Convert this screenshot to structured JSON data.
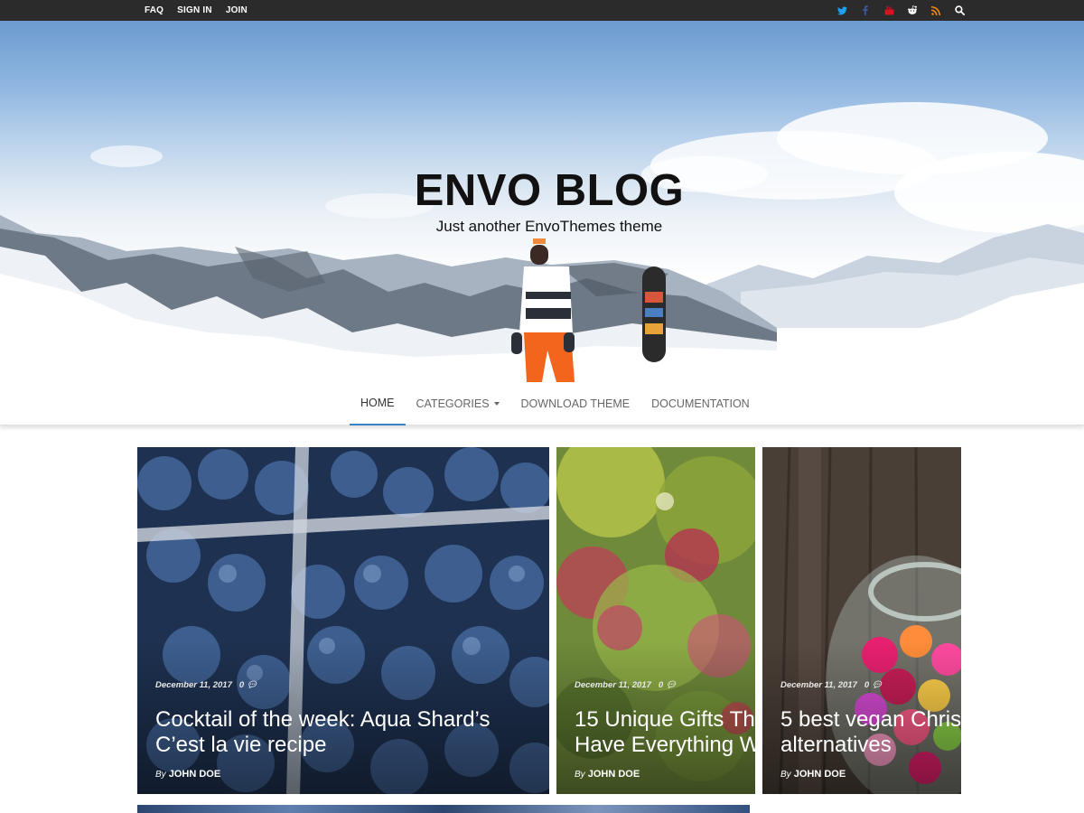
{
  "topbar": {
    "links": [
      "FAQ",
      "SIGN IN",
      "JOIN"
    ],
    "social_icons": [
      "twitter-icon",
      "facebook-icon",
      "youtube-icon",
      "reddit-icon",
      "rss-icon",
      "search-icon"
    ],
    "colors": {
      "twitter": "#1da1f2",
      "facebook": "#3b5998",
      "youtube": "#cc181e",
      "reddit": "#ffffff",
      "rss": "#ff8c00",
      "search": "#ffffff"
    }
  },
  "hero": {
    "site_title": "ENVO BLOG",
    "tagline": "Just another EnvoThemes theme"
  },
  "nav": {
    "items": [
      {
        "label": "HOME",
        "active": true
      },
      {
        "label": "CATEGORIES",
        "dropdown": true
      },
      {
        "label": "DOWNLOAD THEME"
      },
      {
        "label": "DOCUMENTATION"
      }
    ],
    "accent": "#3b82c4"
  },
  "posts": [
    {
      "date": "December 11, 2017",
      "comments": "0",
      "title_lines": [
        "Cocktail of the week: Aqua Shard’s",
        "C’est la vie recipe"
      ],
      "by": "By",
      "author": "JOHN DOE",
      "image": "blueberries"
    },
    {
      "date": "December 11, 2017",
      "comments": "0",
      "title_lines": [
        "15 Unique Gifts Th",
        "Have Everything W"
      ],
      "by": "By",
      "author": "JOHN DOE",
      "image": "flowers-bokeh"
    },
    {
      "date": "December 11, 2017",
      "comments": "0",
      "title_lines": [
        "5 best vegan Chris",
        "alternatives"
      ],
      "by": "By",
      "author": "JOHN DOE",
      "image": "candy-jar-on-wood"
    }
  ]
}
